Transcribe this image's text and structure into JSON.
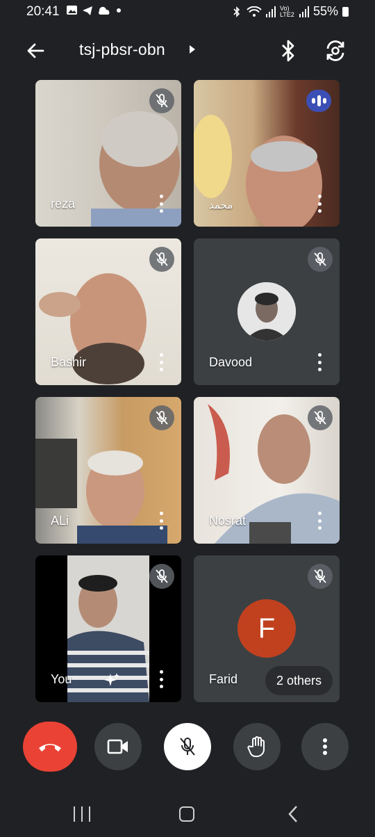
{
  "status": {
    "time": "20:41",
    "left_icons": [
      "gallery-icon",
      "telegram-icon",
      "cloud-icon",
      "dot-icon"
    ],
    "network": "Vo) LTE2",
    "battery": "55%"
  },
  "header": {
    "title": "tsj-pbsr-obn",
    "icons": [
      "back-arrow-icon",
      "bluetooth-icon",
      "switch-camera-icon"
    ]
  },
  "participants": [
    {
      "name": "reza",
      "state": "muted"
    },
    {
      "name": "محمد",
      "state": "speaking"
    },
    {
      "name": "Bashir",
      "state": "muted"
    },
    {
      "name": "Davood",
      "state": "muted"
    },
    {
      "name": "ALi",
      "state": "muted"
    },
    {
      "name": "Nosrat",
      "state": "muted"
    },
    {
      "name": "You",
      "state": "muted"
    },
    {
      "name": "Farid",
      "state": "muted",
      "avatar_letter": "F"
    }
  ],
  "others_label": "2 others",
  "controls": [
    "end-call-icon",
    "video-camera-icon",
    "mic-off-icon",
    "raise-hand-icon",
    "more-vert-icon"
  ],
  "colors": {
    "background": "#202124",
    "tile": "#3c4043",
    "end_call": "#ea4335",
    "farid_avatar": "#c1411f",
    "speaking": "#3c4fb5"
  }
}
